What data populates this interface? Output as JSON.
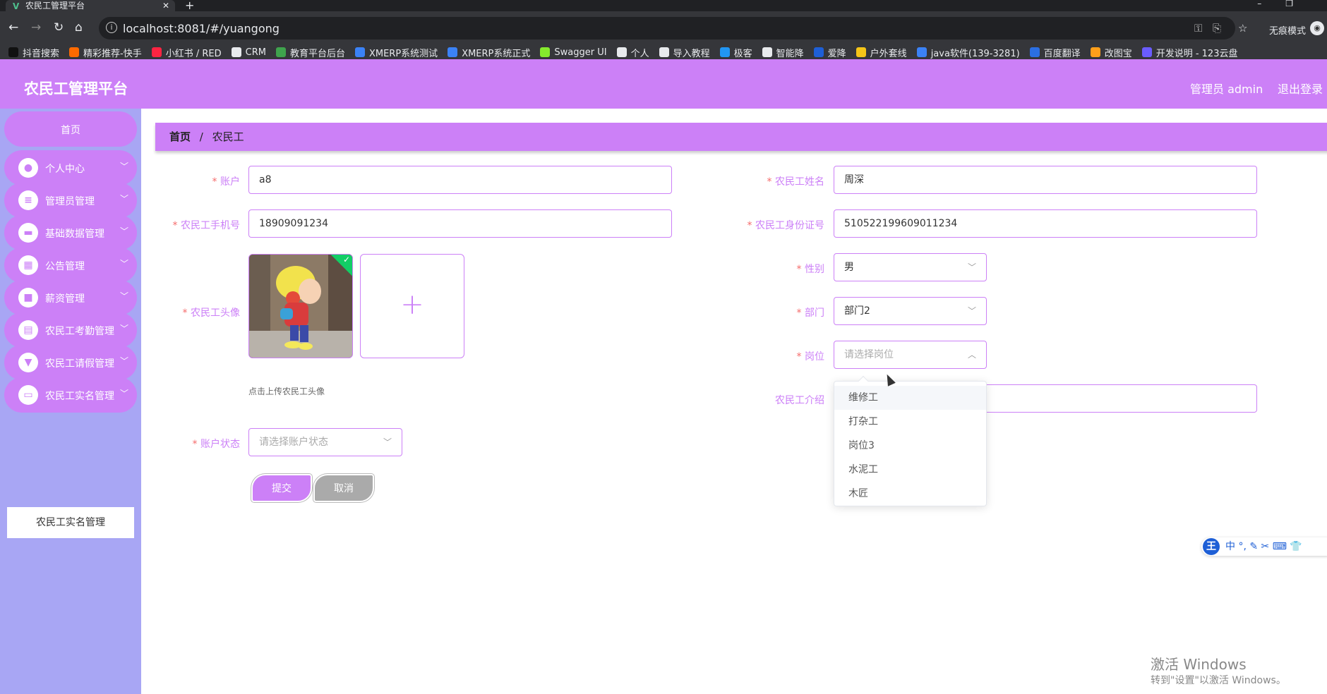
{
  "browser": {
    "tab_title": "农民工管理平台",
    "favicon": "vue-logo-icon",
    "url": "localhost:8081/#/yuangong",
    "incognito_label": "无痕模式",
    "bookmarks": [
      {
        "label": "抖音搜索",
        "color": "#111111"
      },
      {
        "label": "精彩推荐-快手",
        "color": "#ff6a00"
      },
      {
        "label": "小红书 / RED",
        "color": "#ff2442"
      },
      {
        "label": "CRM",
        "color": "#e8eaed"
      },
      {
        "label": "教育平台后台",
        "color": "#3fa34d"
      },
      {
        "label": "XMERP系统测试",
        "color": "#3b82f6"
      },
      {
        "label": "XMERP系统正式",
        "color": "#3b82f6"
      },
      {
        "label": "Swagger UI",
        "color": "#85ea2d"
      },
      {
        "label": "个人",
        "color": "#e8eaed"
      },
      {
        "label": "导入教程",
        "color": "#e8eaed"
      },
      {
        "label": "极客",
        "color": "#2196f3"
      },
      {
        "label": "智能降",
        "color": "#e8eaed"
      },
      {
        "label": "爱降",
        "color": "#1e5fd6"
      },
      {
        "label": "户外套线",
        "color": "#f5c518"
      },
      {
        "label": "java软件(139-3281)",
        "color": "#3b82f6"
      },
      {
        "label": "百度翻译",
        "color": "#2b6fe3"
      },
      {
        "label": "改图宝",
        "color": "#ff9f1a"
      },
      {
        "label": "开发说明 - 123云盘",
        "color": "#6a5cff"
      }
    ]
  },
  "header": {
    "logo": "农民工管理平台",
    "user": "管理员 admin",
    "logout": "退出登录"
  },
  "sidebar": {
    "home": "首页",
    "items": [
      {
        "label": "个人中心",
        "icon": "user-icon",
        "glyph": "●"
      },
      {
        "label": "管理员管理",
        "icon": "sliders-icon",
        "glyph": "≡"
      },
      {
        "label": "基础数据管理",
        "icon": "ticket-icon",
        "glyph": "▬"
      },
      {
        "label": "公告管理",
        "icon": "grid-icon",
        "glyph": "▦"
      },
      {
        "label": "薪资管理",
        "icon": "briefcase-icon",
        "glyph": "■"
      },
      {
        "label": "农民工考勤管理",
        "icon": "clipboard-icon",
        "glyph": "▤"
      },
      {
        "label": "农民工请假管理",
        "icon": "pin-icon",
        "glyph": "▼"
      },
      {
        "label": "农民工实名管理",
        "icon": "monitor-icon",
        "glyph": "▭"
      }
    ],
    "submenu": "农民工实名管理"
  },
  "breadcrumb": {
    "home": "首页",
    "sep": "/",
    "current": "农民工"
  },
  "form": {
    "account": {
      "label": "账户",
      "value": "a8"
    },
    "name": {
      "label": "农民工姓名",
      "value": "周深"
    },
    "phone": {
      "label": "农民工手机号",
      "value": "18909091234"
    },
    "idcard": {
      "label": "农民工身份证号",
      "value": "510522199609011234"
    },
    "avatar": {
      "label": "农民工头像",
      "tip": "点击上传农民工头像"
    },
    "gender": {
      "label": "性别",
      "value": "男"
    },
    "department": {
      "label": "部门",
      "value": "部门2"
    },
    "position": {
      "label": "岗位",
      "placeholder": "请选择岗位"
    },
    "intro": {
      "label": "农民工介绍",
      "value": ""
    },
    "status": {
      "label": "账户状态",
      "placeholder": "请选择账户状态"
    },
    "required_mark": "*",
    "submit": "提交",
    "cancel": "取消"
  },
  "position_options": [
    "维修工",
    "打杂工",
    "岗位3",
    "水泥工",
    "木匠"
  ],
  "ime": {
    "logo": "王",
    "tools": "中 °, ✎ ✂ ⌨ 👕"
  },
  "watermark": {
    "line1": "激活 Windows",
    "line2": "转到\"设置\"以激活 Windows。"
  },
  "colors": {
    "accent": "#cc80f7",
    "sidebar": "#a8a6f4",
    "required": "#f56c6c"
  }
}
